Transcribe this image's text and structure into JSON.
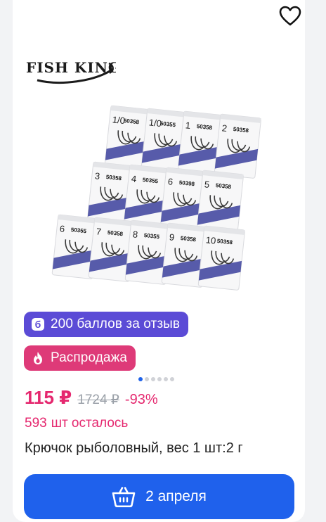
{
  "brand": {
    "logo_text": "FISH KING"
  },
  "badges": {
    "bonus_label": "200 баллов за отзыв",
    "bonus_icon": "б",
    "sale_label": "Распродажа"
  },
  "gallery": {
    "active_index": 0,
    "count": 6
  },
  "price": {
    "current": "115 ₽",
    "old": "1724 ₽",
    "discount": "-93%"
  },
  "stock": {
    "count": "593",
    "unit_text": "шт осталось"
  },
  "product": {
    "title": "Крючок рыболовный, вес 1 шт:2 г"
  },
  "cart": {
    "label": "2 апреля"
  },
  "packs": [
    {
      "size": "1/0",
      "code": "50358"
    },
    {
      "size": "1/0",
      "code": "50355"
    },
    {
      "size": "1",
      "code": "50358"
    },
    {
      "size": "2",
      "code": "50358"
    },
    {
      "size": "3",
      "code": "50358"
    },
    {
      "size": "4",
      "code": "50355"
    },
    {
      "size": "6",
      "code": "50398"
    },
    {
      "size": "5",
      "code": "50358"
    },
    {
      "size": "6",
      "code": "50355"
    },
    {
      "size": "7",
      "code": "50358"
    },
    {
      "size": "8",
      "code": "50355"
    },
    {
      "size": "9",
      "code": "50358"
    },
    {
      "size": "10",
      "code": "50358"
    }
  ],
  "colors": {
    "accent": "#1f61ec",
    "sale": "#e5286f",
    "bonus": "#5b4bd6"
  }
}
